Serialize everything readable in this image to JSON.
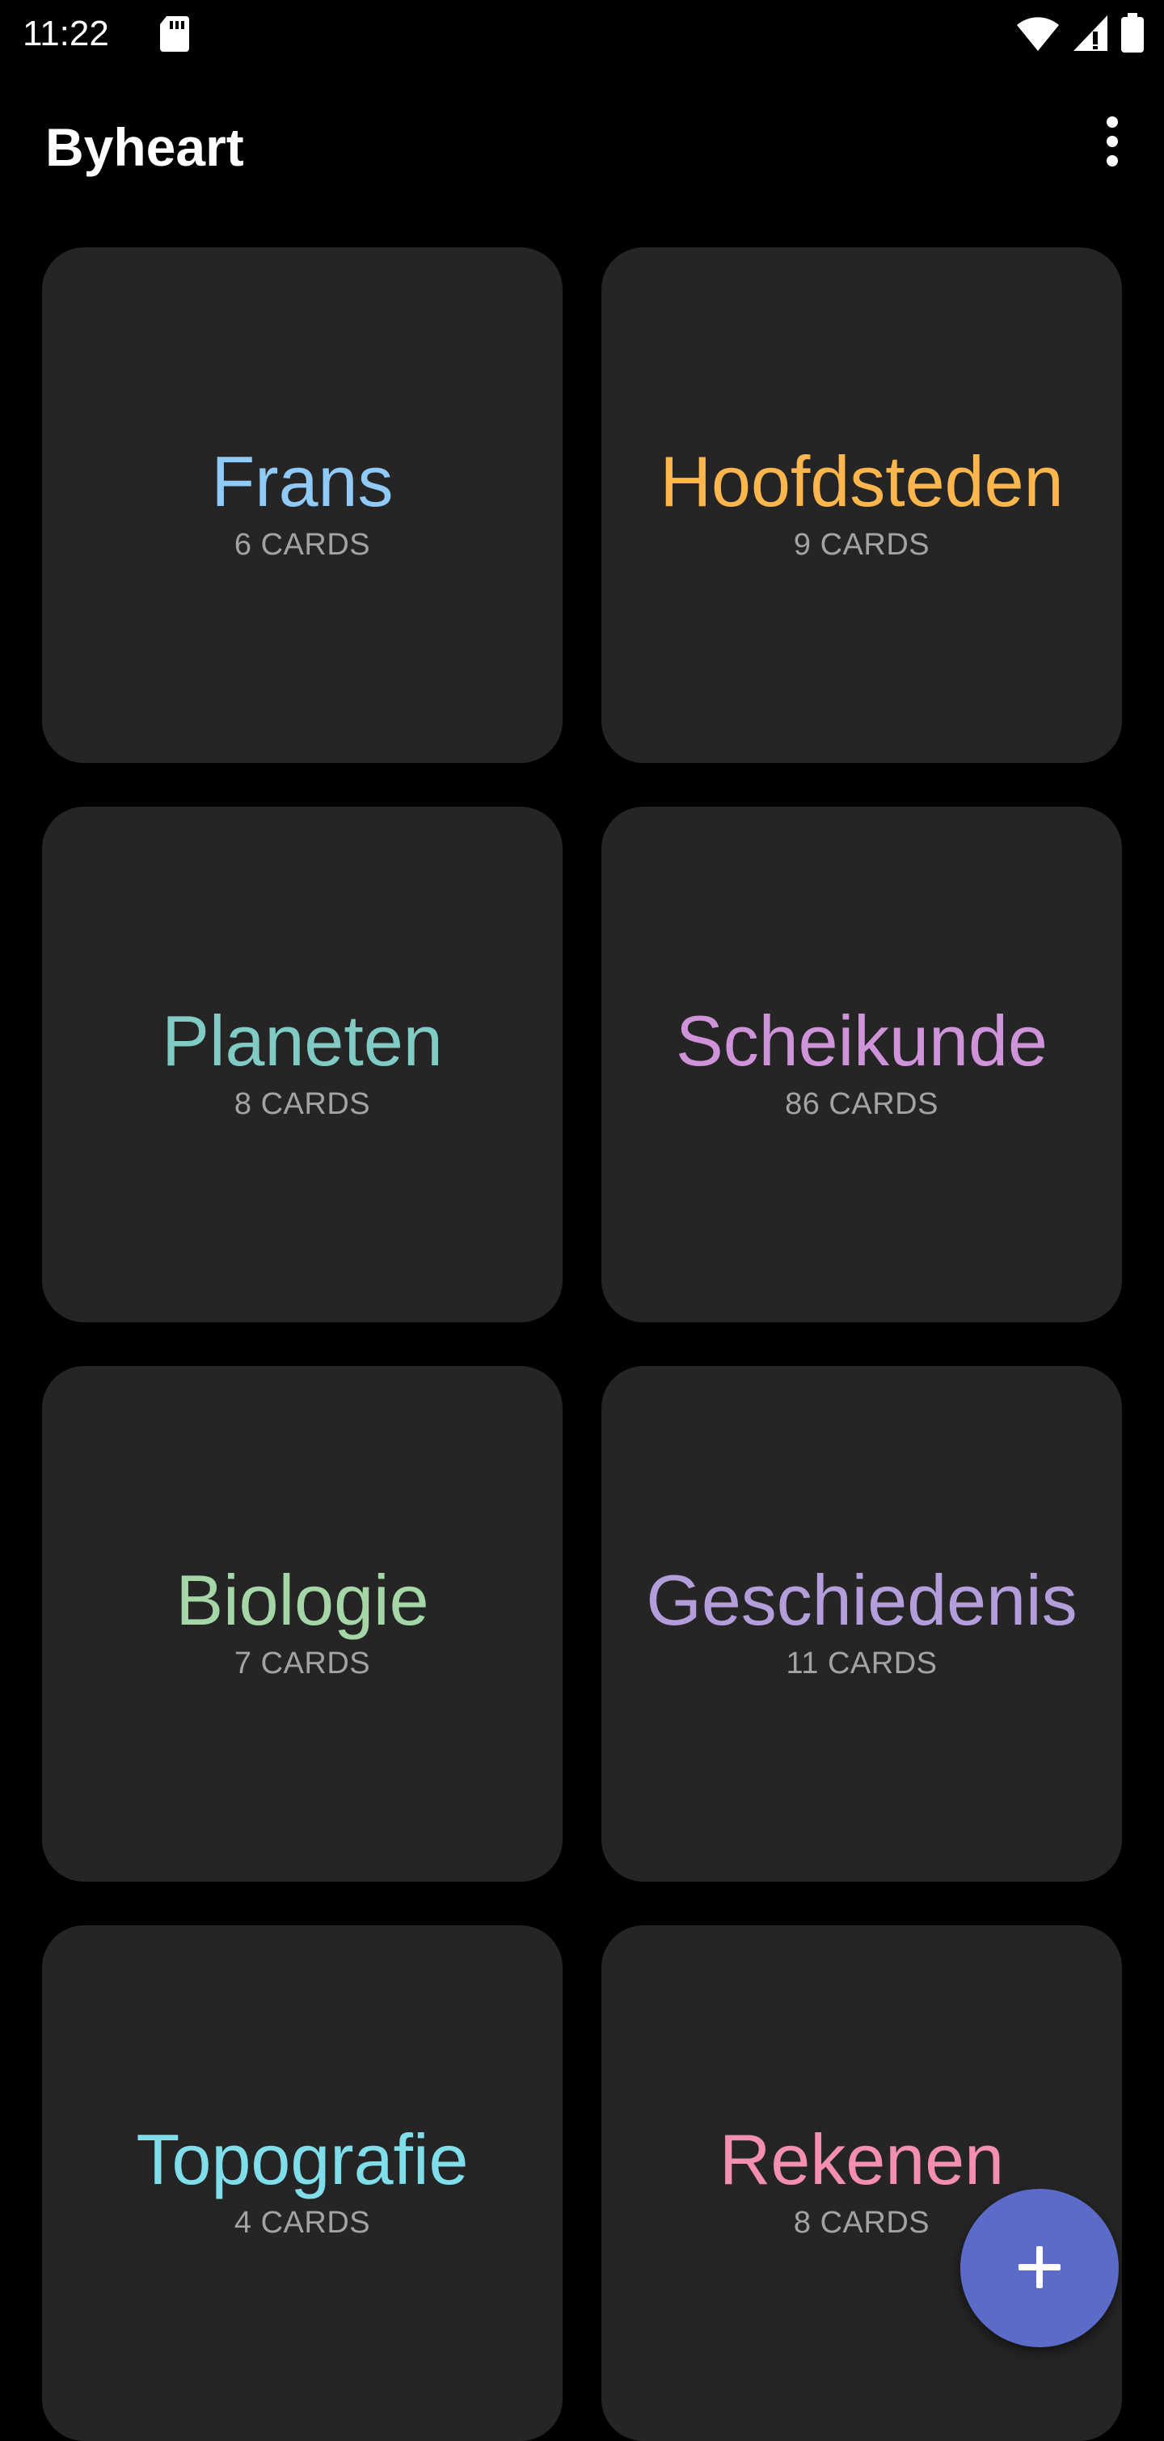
{
  "status_bar": {
    "time": "11:22",
    "icons": [
      "sd-card-icon",
      "wifi-icon",
      "signal-icon",
      "battery-icon"
    ]
  },
  "app_bar": {
    "title": "Byheart",
    "overflow_icon": "more-vert-icon"
  },
  "decks": [
    {
      "name": "Frans",
      "count": "6 CARDS",
      "color": "#90caf9"
    },
    {
      "name": "Hoofdsteden",
      "count": "9 CARDS",
      "color": "#ffb74d"
    },
    {
      "name": "Planeten",
      "count": "8 CARDS",
      "color": "#80cbc4"
    },
    {
      "name": "Scheikunde",
      "count": "86 CARDS",
      "color": "#ce93d8"
    },
    {
      "name": "Biologie",
      "count": "7 CARDS",
      "color": "#a5d6a7"
    },
    {
      "name": "Geschiedenis",
      "count": "11 CARDS",
      "color": "#b39ddb"
    },
    {
      "name": "Topografie",
      "count": "4 CARDS",
      "color": "#80deea"
    },
    {
      "name": "Rekenen",
      "count": "8 CARDS",
      "color": "#f48fb1"
    }
  ],
  "fab": {
    "icon": "plus-icon",
    "color": "#5b6bc7"
  },
  "colors": {
    "background": "#000000",
    "card": "#252525",
    "count_text": "#a3a3a3"
  }
}
